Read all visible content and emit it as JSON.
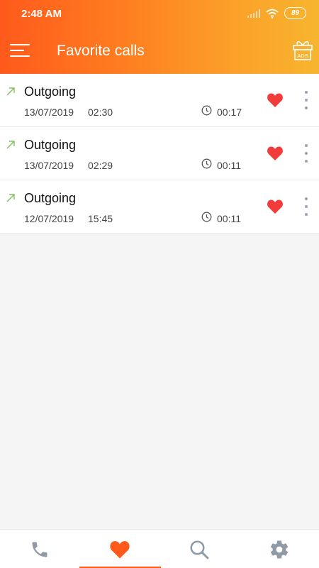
{
  "status_bar": {
    "time": "2:48 AM",
    "battery": "89"
  },
  "toolbar": {
    "title": "Favorite calls",
    "ads_label": "ADS"
  },
  "calls": [
    {
      "type": "Outgoing",
      "date": "13/07/2019",
      "time": "02:30",
      "duration": "00:17"
    },
    {
      "type": "Outgoing",
      "date": "13/07/2019",
      "time": "02:29",
      "duration": "00:11"
    },
    {
      "type": "Outgoing",
      "date": "12/07/2019",
      "time": "15:45",
      "duration": "00:11"
    }
  ],
  "bottom_nav": {
    "items": [
      "phone-icon",
      "heart-icon",
      "search-icon",
      "gear-icon"
    ],
    "active_index": 1
  },
  "colors": {
    "accent": "#ff5a1c",
    "favorite": "#f23b3b",
    "outgoing_arrow": "#7cc15a",
    "inactive_icon": "#8e9aa6"
  }
}
